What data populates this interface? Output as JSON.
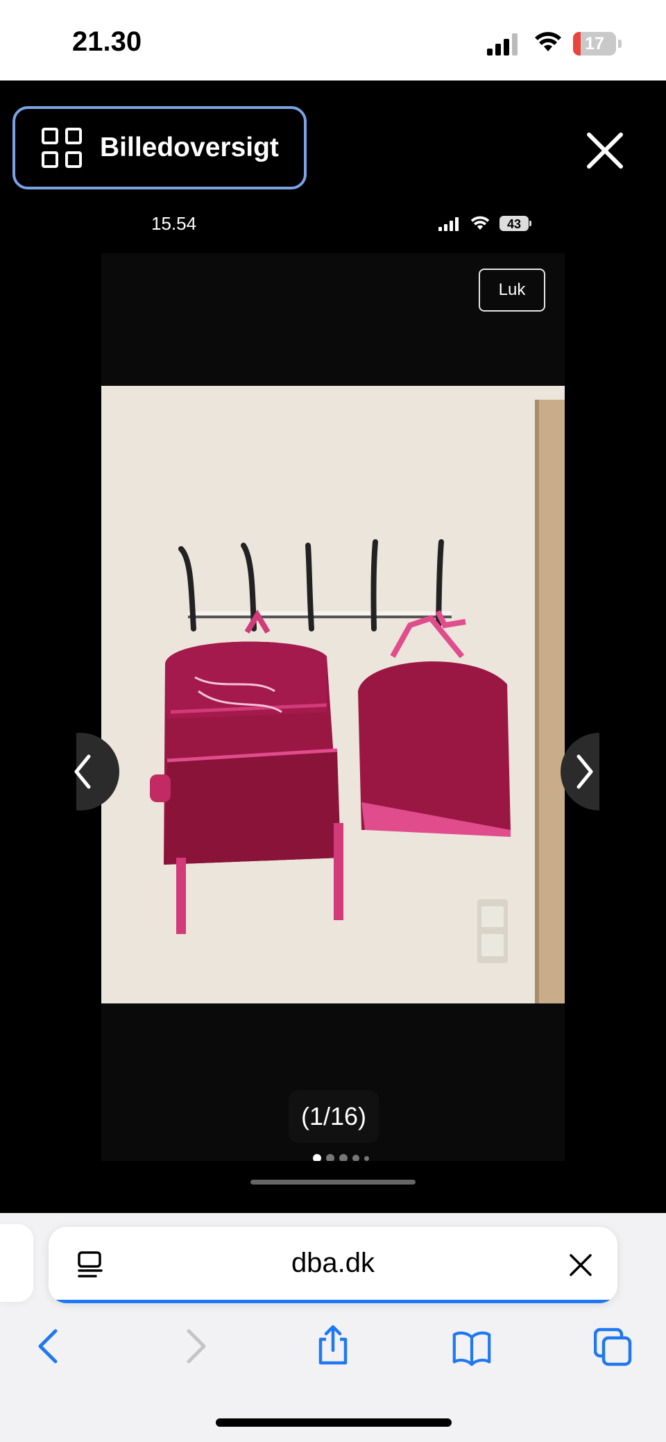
{
  "status_bar": {
    "time": "21.30",
    "battery_level": "17",
    "battery_fraction": 0.17,
    "battery_color": "#e8453c"
  },
  "gallery": {
    "overview_label": "Billedoversigt",
    "accent_color": "#7aa3e6",
    "close_icon": "close-icon"
  },
  "inner_phone": {
    "time": "15.54",
    "battery_level": "43",
    "close_label": "Luk",
    "counter": "(1/16)",
    "dot_count": 5,
    "active_dot": 0,
    "prev_icon": "chevron-left-icon",
    "next_icon": "chevron-right-icon"
  },
  "browser": {
    "url": "dba.dk",
    "progress_color": "#1f78f0",
    "toolbar": [
      "back-icon",
      "forward-icon",
      "share-icon",
      "bookmarks-icon",
      "tabs-icon"
    ]
  }
}
